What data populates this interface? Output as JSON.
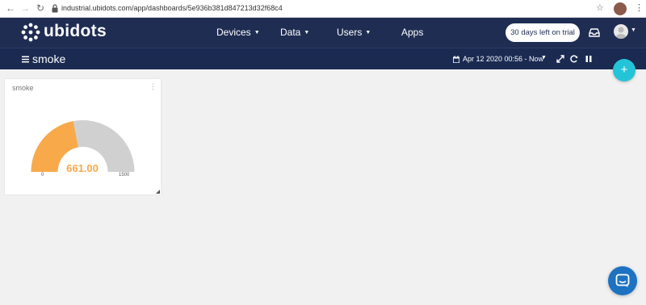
{
  "browser": {
    "url": "industrial.ubidots.com/app/dashboards/5e936b381d847213d32f68c4"
  },
  "header": {
    "logo_text": "ubidots",
    "menu": [
      {
        "label": "Devices"
      },
      {
        "label": "Data"
      },
      {
        "label": "Users"
      },
      {
        "label": "Apps"
      }
    ],
    "trial_label": "30 days left on trial"
  },
  "dashboard": {
    "title": "smoke",
    "date_range": "Apr 12 2020 00:56 - Now"
  },
  "widget": {
    "title": "smoke",
    "value": "661.00",
    "min": "0",
    "max": "1500",
    "value_fraction": 0.4407
  },
  "colors": {
    "topbar": "#1f2d53",
    "gauge_fill": "#f8a94a",
    "gauge_track": "#d0d0d0",
    "fab": "#23c4d8",
    "chat": "#1d72c2"
  }
}
